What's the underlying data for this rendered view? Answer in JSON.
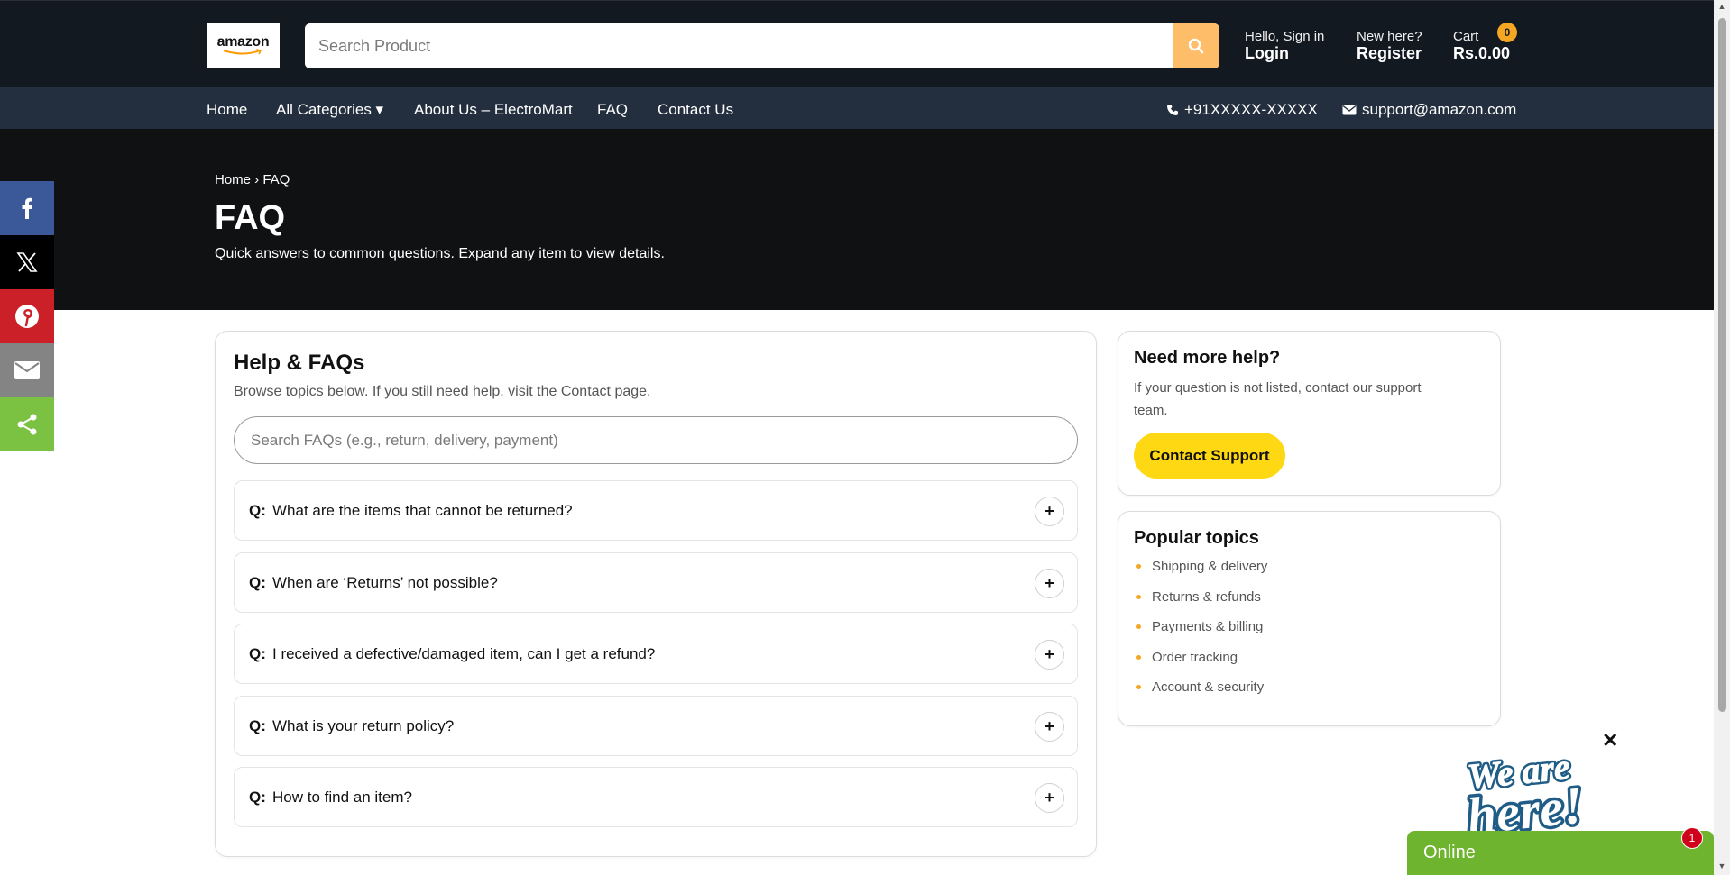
{
  "header": {
    "logo_text": "amazon",
    "search_placeholder": "Search Product",
    "signin_small": "Hello, Sign in",
    "signin_big": "Login",
    "register_small": "New here?",
    "register_big": "Register",
    "cart_small": "Cart",
    "cart_total": "Rs.0.00",
    "cart_count": "0"
  },
  "nav": {
    "items": [
      "Home",
      "All Categories ▾",
      "About Us – ElectroMart",
      "FAQ",
      "Contact Us"
    ],
    "phone": "+91XXXXX-XXXXX",
    "email": "support@amazon.com"
  },
  "hero": {
    "breadcrumb": "Home › FAQ",
    "title": "FAQ",
    "subtitle": "Quick answers to common questions. Expand any item to view details."
  },
  "share_icons": [
    "facebook-icon",
    "x-icon",
    "pinterest-icon",
    "email-icon",
    "share-icon"
  ],
  "colors": {
    "header_bg": "#131921",
    "nav_bg": "#232f3e",
    "search_button": "#febd69",
    "accent_yellow": "#ffd814",
    "facebook": "#3b5998",
    "pinterest": "#cb2027",
    "email": "#848484",
    "share": "#7bc142",
    "chat_green": "#6fb42f"
  },
  "faq": {
    "title": "Help & FAQs",
    "subtitle": "Browse topics below. If you still need help, visit the Contact page.",
    "search_placeholder": "Search FAQs (e.g., return, delivery, payment)",
    "q_label": "Q:",
    "items": [
      "What are the items that cannot be returned?",
      "When are ‘Returns’ not possible?",
      "I received a defective/damaged item, can I get a refund?",
      "What is your return policy?",
      "How to find an item?"
    ]
  },
  "help": {
    "title": "Need more help?",
    "description": "If your question is not listed, contact our support team.",
    "button": "Contact Support"
  },
  "topics": {
    "title": "Popular topics",
    "items": [
      "Shipping & delivery",
      "Returns & refunds",
      "Payments & billing",
      "Order tracking",
      "Account & security"
    ]
  },
  "chat": {
    "banner_text": "We are here!",
    "status": "Online",
    "badge": "1"
  }
}
